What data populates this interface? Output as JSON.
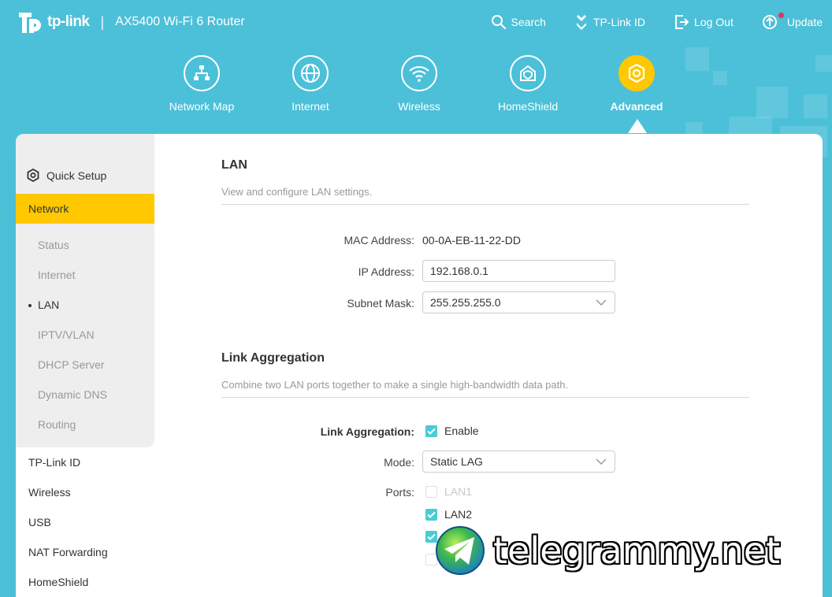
{
  "header": {
    "logo_text": "tp-link",
    "separator": "|",
    "model": "AX5400 Wi-Fi 6 Router",
    "actions": [
      {
        "label": "Search",
        "icon": "search-icon"
      },
      {
        "label": "TP-Link ID",
        "icon": "user-id-icon"
      },
      {
        "label": "Log Out",
        "icon": "logout-icon"
      },
      {
        "label": "Update",
        "icon": "update-icon"
      }
    ]
  },
  "nav": [
    {
      "label": "Network Map",
      "icon": "network-map-icon",
      "active": false
    },
    {
      "label": "Internet",
      "icon": "globe-icon",
      "active": false
    },
    {
      "label": "Wireless",
      "icon": "wifi-icon",
      "active": false
    },
    {
      "label": "HomeShield",
      "icon": "home-shield-icon",
      "active": false
    },
    {
      "label": "Advanced",
      "icon": "gear-icon",
      "active": true
    }
  ],
  "sidebar": {
    "quick_setup": "Quick Setup",
    "network": "Network",
    "network_items": [
      "Status",
      "Internet",
      "LAN",
      "IPTV/VLAN",
      "DHCP Server",
      "Dynamic DNS",
      "Routing"
    ],
    "active_item": "LAN",
    "main_items": [
      "TP-Link ID",
      "Wireless",
      "USB",
      "NAT Forwarding",
      "HomeShield"
    ]
  },
  "lan": {
    "title": "LAN",
    "description": "View and configure LAN settings.",
    "mac_label": "MAC Address:",
    "mac_value": "00-0A-EB-11-22-DD",
    "ip_label": "IP Address:",
    "ip_value": "192.168.0.1",
    "subnet_label": "Subnet Mask:",
    "subnet_value": "255.255.255.0"
  },
  "link_agg": {
    "title": "Link Aggregation",
    "description": "Combine two LAN ports together to make a single high-bandwidth data path.",
    "enable_label": "Link Aggregation:",
    "enable_text": "Enable",
    "mode_label": "Mode:",
    "mode_value": "Static LAG",
    "ports_label": "Ports:",
    "ports": [
      {
        "label": "LAN1",
        "checked": false,
        "disabled": true
      },
      {
        "label": "LAN2",
        "checked": true,
        "disabled": false
      }
    ]
  },
  "watermark": {
    "text": "telegrammy.net"
  },
  "colors": {
    "header_bg": "#4cc0d8",
    "accent_yellow": "#ffc800",
    "checkbox": "#4acbd6"
  }
}
